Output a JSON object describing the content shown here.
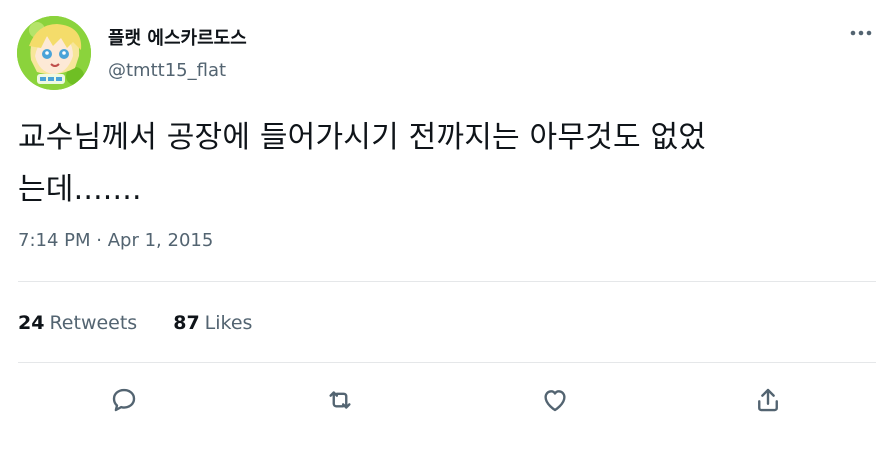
{
  "author": {
    "display_name": "플랫 에스카르도스",
    "handle": "@tmtt15_flat"
  },
  "icons": {
    "more": "more-horizontal-icon",
    "reply": "reply-icon",
    "retweet": "retweet-icon",
    "like": "like-heart-icon",
    "share": "share-icon"
  },
  "tweet": {
    "text_line1": "교수님께서 공장에 들어가시기 전까지는 아무것도 없었",
    "text_line2": "는데.......",
    "time": "7:14 PM",
    "separator": "·",
    "date": "Apr 1, 2015"
  },
  "stats": {
    "retweets_count": "24",
    "retweets_label": "Retweets",
    "likes_count": "87",
    "likes_label": "Likes"
  },
  "colors": {
    "text_primary": "#0f1419",
    "text_secondary": "#536471",
    "divider": "#e5e7e9",
    "avatar_bg": "#8bd33c"
  }
}
